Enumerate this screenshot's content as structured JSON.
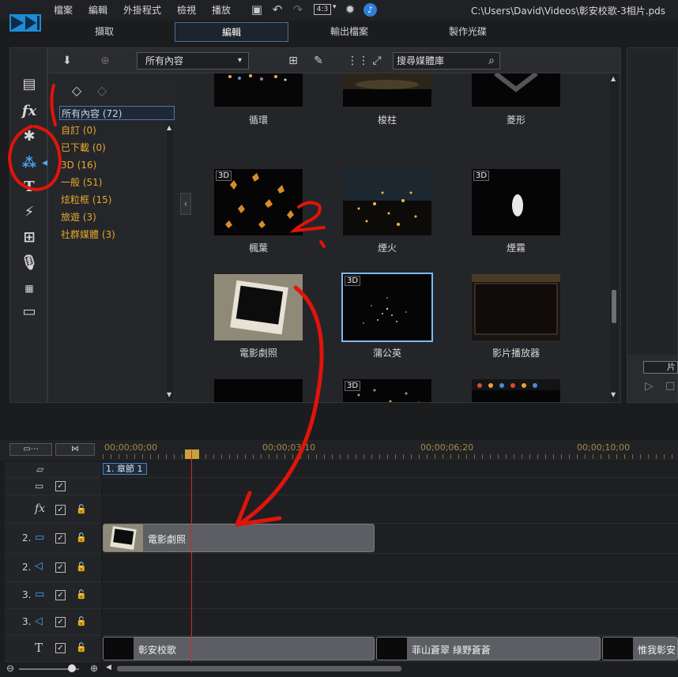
{
  "menu": {
    "items": [
      "檔案",
      "編輯",
      "外掛程式",
      "檢視",
      "播放"
    ],
    "aspect": "4:3",
    "path": "C:\\Users\\David\\Videos\\彰安校歌-3相片.pds"
  },
  "tabs": [
    "擷取",
    "編輯",
    "輸出檔案",
    "製作光碟"
  ],
  "library": {
    "dropdown": "所有內容",
    "search_placeholder": "搜尋媒體庫",
    "categories": [
      "所有內容 (72)",
      "自訂 (0)",
      "已下載 (0)",
      "3D (16)",
      "一般 (51)",
      "炫粒框 (15)",
      "旅遊 (3)",
      "社群媒體 (3)"
    ],
    "thumbs_row1": [
      "循環",
      "梭柱",
      "菱形"
    ],
    "thumbs_row2": [
      "楓葉",
      "煙火",
      "煙霧"
    ],
    "thumbs_row3": [
      "電影劇照",
      "蒲公英",
      "影片播放器"
    ],
    "badge_3d": "3D"
  },
  "preview": {
    "button": "片"
  },
  "timeline": {
    "timecodes": [
      "00;00;00;00",
      "00;00;03;10",
      "00;00;06;20",
      "00;00;10;00"
    ],
    "chapter": "1. 章節 1",
    "track_nums": {
      "video2": "2.",
      "audio2": "2.",
      "video3": "3.",
      "audio3": "3."
    },
    "clip_video": "電影劇照",
    "title_clips": [
      "彰安校歌",
      "菲山蒼翠 綠野蒼蒼",
      "惟我彰安"
    ]
  },
  "icons": {
    "undo": "undo-icon",
    "redo": "redo-icon",
    "save": "save-icon"
  }
}
